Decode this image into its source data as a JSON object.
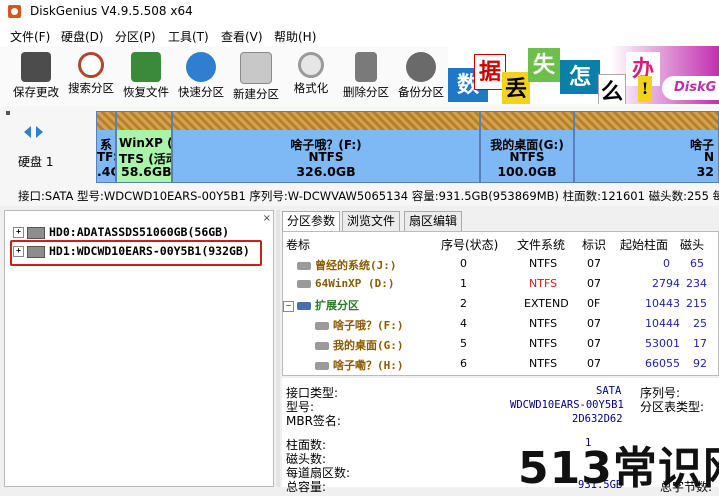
{
  "title": "DiskGenius V4.9.5.508 x64",
  "menu": [
    "文件(F)",
    "硬盘(D)",
    "分区(P)",
    "工具(T)",
    "查看(V)",
    "帮助(H)"
  ],
  "toolbar": [
    {
      "label": "保存更改",
      "icon": "save-icon",
      "color": "#4c4c4c"
    },
    {
      "label": "搜索分区",
      "icon": "search-icon",
      "color": "#b0462d"
    },
    {
      "label": "恢复文件",
      "icon": "recover-icon",
      "color": "#3b8a3b"
    },
    {
      "label": "快速分区",
      "icon": "quick-partition-icon",
      "color": "#2f7fd0"
    },
    {
      "label": "新建分区",
      "icon": "new-partition-icon",
      "color": "#8a8a8a"
    },
    {
      "label": "格式化",
      "icon": "format-icon",
      "color": "#9a9a9a"
    },
    {
      "label": "删除分区",
      "icon": "delete-icon",
      "color": "#7a7a7a"
    },
    {
      "label": "备份分区",
      "icon": "backup-icon",
      "color": "#6a6a6a"
    }
  ],
  "banner": {
    "chars": [
      "数",
      "据",
      "丢",
      "失",
      "怎",
      "么",
      "办",
      "!"
    ],
    "logo": "DiskG"
  },
  "diskmap": {
    "disk_label": "硬盘 1",
    "partitions": [
      {
        "name": "系",
        "fs": "TFS",
        "size": ".4G"
      },
      {
        "name": "WinXP (D",
        "fs": "TFS (活动",
        "size": "58.6GB"
      },
      {
        "name": "啥子哦？(F:)",
        "fs": "NTFS",
        "size": "326.0GB"
      },
      {
        "name": "我的桌面(G:)",
        "fs": "NTFS",
        "size": "100.0GB"
      },
      {
        "name": "啥子",
        "fs": "N",
        "size": "32"
      }
    ],
    "info": "接口:SATA  型号:WDCWD10EARS-00Y5B1  序列号:W-DCWVAW5065134  容量:931.5GB(953869MB)  柱面数:121601  磁头数:255  每道扇"
  },
  "tree": {
    "nodes": [
      "HD0:ADATASSDS51060GB(56GB)",
      "HD1:WDCWD10EARS-00Y5B1(932GB)"
    ]
  },
  "tabs": [
    "分区参数",
    "浏览文件",
    "扇区编辑"
  ],
  "grid": {
    "headers": [
      "卷标",
      "序号(状态)",
      "文件系统",
      "标识",
      "起始柱面",
      "磁头"
    ],
    "rows": [
      {
        "name": "曾经的系统(J:)",
        "num": "0",
        "fs": "NTFS",
        "id": "07",
        "start": "0",
        "head": "65",
        "fs_color": "#000"
      },
      {
        "name": "64WinXP (D:)",
        "num": "1",
        "fs": "NTFS",
        "id": "07",
        "start": "2794",
        "head": "234",
        "fs_color": "#d21b1b"
      },
      {
        "name": "扩展分区",
        "num": "2",
        "fs": "EXTEND",
        "id": "0F",
        "start": "10443",
        "head": "215",
        "fs_color": "#000"
      },
      {
        "name": "啥子哦？(F:)",
        "num": "4",
        "fs": "NTFS",
        "id": "07",
        "start": "10444",
        "head": "25",
        "fs_color": "#000"
      },
      {
        "name": "我的桌面(G:)",
        "num": "5",
        "fs": "NTFS",
        "id": "07",
        "start": "53001",
        "head": "17",
        "fs_color": "#000"
      },
      {
        "name": "啥子嘞？(H:)",
        "num": "6",
        "fs": "NTFS",
        "id": "07",
        "start": "66055",
        "head": "92",
        "fs_color": "#000"
      }
    ]
  },
  "details": {
    "interface_label": "接口类型:",
    "interface_value": "SATA",
    "serial_label": "序列号:",
    "model_label": "型号:",
    "model_value": "WDCWD10EARS-00Y5B1",
    "ptype_label": "分区表类型:",
    "mbr_label": "MBR签名:",
    "mbr_value": "2D632D62",
    "cyl_label": "柱面数:",
    "cyl_value": "1",
    "heads_label": "磁头数:",
    "spt_label": "每道扇区数:",
    "cap_label": "总容量:",
    "cap_value": "931.5GB",
    "total_label": "总字节数:"
  },
  "watermark": "513常识网"
}
